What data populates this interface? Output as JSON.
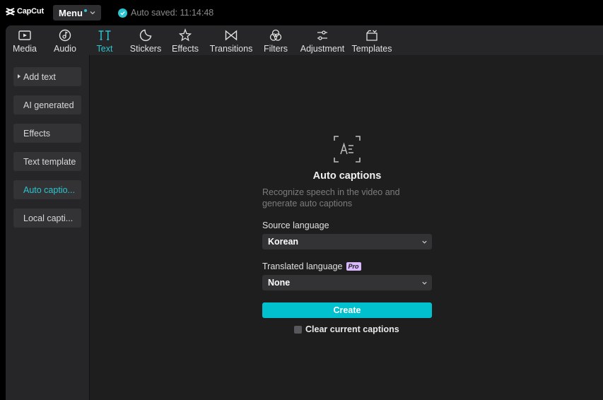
{
  "app": {
    "logo_text": "CapCut",
    "menu_label": "Menu",
    "autosave_text": "Auto saved: 11:14:48"
  },
  "colors": {
    "accent": "#2bc4d0",
    "create_button": "#00c1cd",
    "pro_badge": "#d9b8ff"
  },
  "tabs": [
    {
      "label": "Media",
      "icon": "media-icon"
    },
    {
      "label": "Audio",
      "icon": "audio-icon"
    },
    {
      "label": "Text",
      "icon": "text-icon",
      "active": true
    },
    {
      "label": "Stickers",
      "icon": "sticker-icon"
    },
    {
      "label": "Effects",
      "icon": "effects-icon"
    },
    {
      "label": "Transitions",
      "icon": "transitions-icon"
    },
    {
      "label": "Filters",
      "icon": "filters-icon"
    },
    {
      "label": "Adjustment",
      "icon": "adjustment-icon"
    },
    {
      "label": "Templates",
      "icon": "templates-icon"
    }
  ],
  "sidebar": {
    "items": [
      {
        "label": "Add text"
      },
      {
        "label": "AI generated"
      },
      {
        "label": "Effects"
      },
      {
        "label": "Text template"
      },
      {
        "label": "Auto captio...",
        "active": true
      },
      {
        "label": "Local capti..."
      }
    ]
  },
  "captions": {
    "title": "Auto captions",
    "description": "Recognize speech in the video and generate auto captions",
    "source_label": "Source language",
    "source_value": "Korean",
    "translated_label": "Translated language",
    "pro_badge": "Pro",
    "translated_value": "None",
    "create_label": "Create",
    "clear_label": "Clear current captions"
  }
}
